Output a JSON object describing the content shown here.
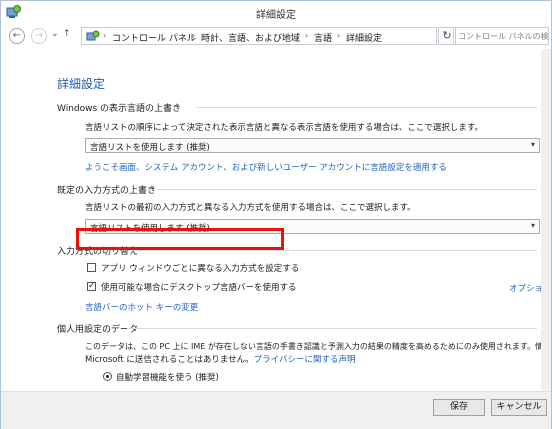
{
  "window": {
    "title": "詳細設定"
  },
  "nav": {
    "back_glyph": "←",
    "forward_glyph": "→",
    "dropdown_glyph": "⌄",
    "up_glyph": "↑",
    "breadcrumbs": [
      "コントロール パネル",
      "時計、言語、および地域",
      "言語",
      "詳細設定"
    ],
    "separator": "›",
    "refresh_glyph": "↻",
    "search_placeholder": "コントロール パネルの検索"
  },
  "main": {
    "heading": "詳細設定",
    "display_language": {
      "title": "Windows の表示言語の上書き",
      "description": "言語リストの順序によって決定された表示言語と異なる表示言語を使用する場合は、ここで選択します。",
      "select_value": "言語リストを使用します (推奨)",
      "apply_link": "ようこそ画面、システム アカウント、および新しいユーザー アカウントに言語設定を適用する"
    },
    "input_method": {
      "title": "既定の入力方式の上書き",
      "description": "言語リストの最初の入力方式と異なる入力方式を使用する場合は、ここで選択します。",
      "select_value": "言語リストを使用します (推奨)"
    },
    "switching": {
      "title": "入力方式の切り替え",
      "per_app_label": "アプリ ウィンドウごとに異なる入力方式を設定する",
      "per_app_checked": false,
      "desktop_bar_label": "使用可能な場合にデスクトップ言語バーを使用する",
      "desktop_bar_checked": true,
      "options_link": "オプション",
      "hotkey_link": "言語バーのホット キーの変更"
    },
    "personalization": {
      "title": "個人用設定のデータ",
      "description_line1": "このデータは、この PC 上に IME が存在しない言語の手書き認識と予測入力の結果の精度を高めるためにのみ使用されます。情報が",
      "description_line2": "Microsoft に送信されることはありません。",
      "privacy_link": "プライバシーに関する声明",
      "radio_label": "自動学習機能を使う (推奨)"
    }
  },
  "footer": {
    "save_label": "保存",
    "cancel_label": "キャンセル"
  },
  "colors": {
    "accent": "#1e5ea8",
    "link": "#1c63c0",
    "highlight": "#e8110c"
  }
}
